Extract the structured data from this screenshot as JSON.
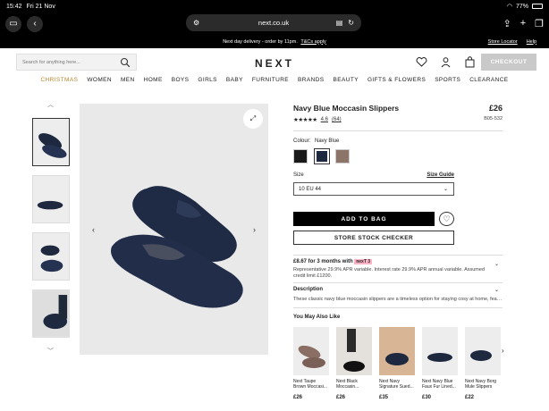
{
  "status_bar": {
    "time": "15:42",
    "date": "Fri 21 Nov",
    "battery": "77%"
  },
  "browser": {
    "url": "next.co.uk"
  },
  "promo_bar": {
    "message": "Next day delivery - order by 11pm.",
    "link": "T&Cs apply",
    "store_locator": "Store Locator",
    "help": "Help"
  },
  "header": {
    "search_placeholder": "Search for anything here...",
    "logo": "NEXT",
    "checkout": "CHECKOUT"
  },
  "nav": [
    "CHRISTMAS",
    "WOMEN",
    "MEN",
    "HOME",
    "BOYS",
    "GIRLS",
    "BABY",
    "FURNITURE",
    "BRANDS",
    "BEAUTY",
    "GIFTS & FLOWERS",
    "SPORTS",
    "CLEARANCE"
  ],
  "product": {
    "title": "Navy Blue Moccasin Slippers",
    "price": "£26",
    "code": "B05-532",
    "stars": "★★★★★",
    "rating": "4.6",
    "reviews": "(64)",
    "colour_label": "Colour:",
    "colour_value": "Navy Blue",
    "size_label": "Size",
    "size_guide": "Size Guide",
    "size_selected": "10 EU 44",
    "add_to_bag": "ADD TO BAG",
    "store_stock": "STORE STOCK CHECKER",
    "finance_title": "£8.67 for 3 months with",
    "finance_brand": "nexT 3",
    "finance_detail": "Representative 29.9% APR variable. Interest rate 29.9% APR annual variable. Assumed credit limit £1200.",
    "description_title": "Description",
    "description_text": "These classic navy blue moccasin slippers are a timeless option for staying cosy at home, featurin..."
  },
  "recommendations": {
    "title": "You May Also Like",
    "items": [
      {
        "name": "Next Taupe Brown Moccasi...",
        "price": "£26"
      },
      {
        "name": "Next Black Moccasin...",
        "price": "£26"
      },
      {
        "name": "Next Navy Signature Sued...",
        "price": "£35"
      },
      {
        "name": "Next Navy Blue Faux Fur Lined...",
        "price": "£30"
      },
      {
        "name": "Next Navy Borg Mule Slippers",
        "price": "£22"
      }
    ]
  },
  "colors": {
    "navy": "#1e2940",
    "gold": "#b8862b",
    "swatch_black": "#1a1a1a",
    "swatch_taupe": "#8c7468"
  }
}
